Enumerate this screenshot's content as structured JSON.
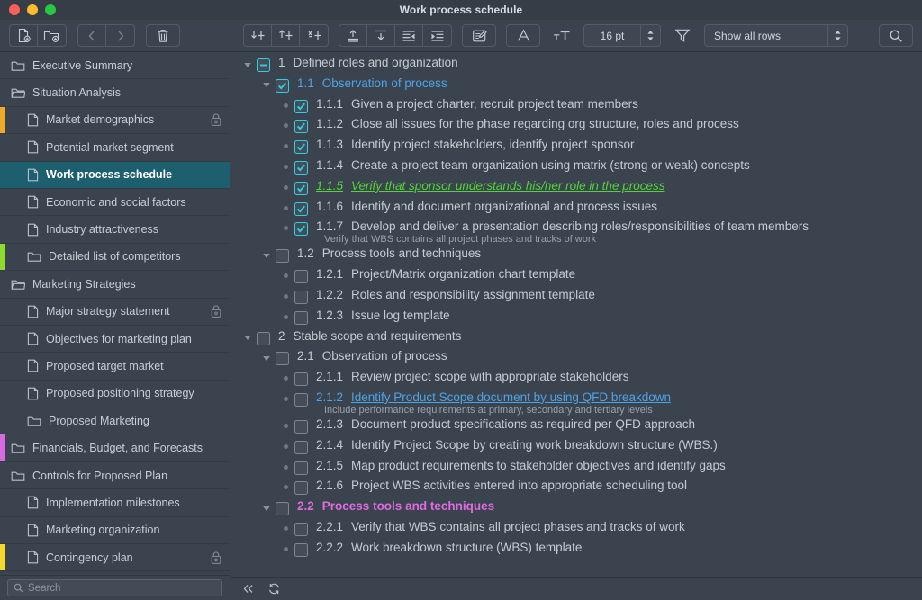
{
  "window": {
    "title": "Work process schedule",
    "traffic_lights": [
      "close",
      "minimize",
      "zoom"
    ]
  },
  "toolbar": {
    "left_groups": [
      {
        "buttons": [
          {
            "name": "new-document-button",
            "icon": "document-add-icon"
          },
          {
            "name": "new-folder-button",
            "icon": "folder-add-icon"
          }
        ]
      },
      {
        "buttons": [
          {
            "name": "back-button",
            "icon": "chevron-left-icon",
            "disabled": true
          },
          {
            "name": "forward-button",
            "icon": "chevron-right-icon",
            "disabled": true
          }
        ]
      },
      {
        "buttons": [
          {
            "name": "delete-button",
            "icon": "trash-icon"
          }
        ]
      }
    ],
    "right_groups": [
      {
        "buttons": [
          {
            "name": "add-row-below-button",
            "icon": "row-add-below-icon"
          },
          {
            "name": "add-row-above-button",
            "icon": "row-add-above-icon"
          },
          {
            "name": "add-child-row-button",
            "icon": "row-add-child-icon"
          }
        ]
      },
      {
        "buttons": [
          {
            "name": "move-row-up-button",
            "icon": "move-up-icon"
          },
          {
            "name": "move-row-down-button",
            "icon": "move-down-icon"
          },
          {
            "name": "outdent-button",
            "icon": "outdent-icon"
          },
          {
            "name": "indent-button",
            "icon": "indent-icon"
          }
        ]
      },
      {
        "buttons": [
          {
            "name": "edit-note-button",
            "icon": "note-edit-icon"
          }
        ]
      },
      {
        "buttons": [
          {
            "name": "font-style-button",
            "icon": "font-a-icon"
          }
        ]
      }
    ],
    "font_size": {
      "label": "16 pt",
      "icon": "text-size-icon"
    },
    "filter": {
      "icon": "funnel-icon",
      "value": "Show all rows"
    },
    "search_button": {
      "icon": "search-icon"
    }
  },
  "sidebar": {
    "items": [
      {
        "label": "Executive Summary",
        "icon": "folder-icon",
        "depth": 0,
        "edge": null,
        "locked": false,
        "selected": false
      },
      {
        "label": "Situation Analysis",
        "icon": "folder-open-icon",
        "depth": 0,
        "edge": null,
        "locked": false,
        "selected": false
      },
      {
        "label": "Market demographics",
        "icon": "document-icon",
        "depth": 1,
        "edge": "#f0a829",
        "locked": true,
        "selected": false
      },
      {
        "label": "Potential market segment",
        "icon": "document-icon",
        "depth": 1,
        "edge": null,
        "locked": false,
        "selected": false
      },
      {
        "label": "Work process schedule",
        "icon": "document-icon",
        "depth": 1,
        "edge": "#1d5f6e",
        "locked": false,
        "selected": true
      },
      {
        "label": "Economic and social factors",
        "icon": "document-icon",
        "depth": 1,
        "edge": null,
        "locked": false,
        "selected": false
      },
      {
        "label": "Industry attractiveness",
        "icon": "document-icon",
        "depth": 1,
        "edge": null,
        "locked": false,
        "selected": false
      },
      {
        "label": "Detailed list of competitors",
        "icon": "folder-icon",
        "depth": 1,
        "edge": "#8fdb2b",
        "locked": false,
        "selected": false
      },
      {
        "label": "Marketing Strategies",
        "icon": "folder-open-icon",
        "depth": 0,
        "edge": null,
        "locked": false,
        "selected": false
      },
      {
        "label": "Major strategy statement",
        "icon": "document-icon",
        "depth": 1,
        "edge": null,
        "locked": true,
        "selected": false
      },
      {
        "label": "Objectives for marketing plan",
        "icon": "document-icon",
        "depth": 1,
        "edge": null,
        "locked": false,
        "selected": false
      },
      {
        "label": "Proposed target market",
        "icon": "document-icon",
        "depth": 1,
        "edge": null,
        "locked": false,
        "selected": false
      },
      {
        "label": "Proposed positioning strategy",
        "icon": "document-icon",
        "depth": 1,
        "edge": null,
        "locked": false,
        "selected": false
      },
      {
        "label": "Proposed Marketing",
        "icon": "folder-icon",
        "depth": 1,
        "edge": null,
        "locked": false,
        "selected": false
      },
      {
        "label": "Financials, Budget, and Forecasts",
        "icon": "folder-icon",
        "depth": 0,
        "edge": "#d66ae0",
        "locked": false,
        "selected": false
      },
      {
        "label": "Controls for Proposed Plan",
        "icon": "folder-icon",
        "depth": 0,
        "edge": null,
        "locked": false,
        "selected": false
      },
      {
        "label": "Implementation milestones",
        "icon": "document-icon",
        "depth": 1,
        "edge": null,
        "locked": false,
        "selected": false
      },
      {
        "label": "Marketing organization",
        "icon": "document-icon",
        "depth": 1,
        "edge": null,
        "locked": false,
        "selected": false
      },
      {
        "label": "Contingency plan",
        "icon": "document-icon",
        "depth": 1,
        "edge": "#f2d92b",
        "locked": true,
        "selected": false
      }
    ],
    "search": {
      "placeholder": "Search",
      "icon": "search-icon"
    }
  },
  "outline": {
    "rows": [
      {
        "indent": 0,
        "marker": "triangle-down",
        "check": "partial",
        "number": "1",
        "title": "Defined roles and organization",
        "note": null,
        "style": "normal"
      },
      {
        "indent": 1,
        "marker": "triangle-down",
        "check": "checked",
        "number": "1.1",
        "title": "Observation of process",
        "note": null,
        "style": "blue"
      },
      {
        "indent": 2,
        "marker": "bullet",
        "check": "checked",
        "number": "1.1.1",
        "title": "Given a project charter, recruit project team members",
        "note": null,
        "style": "normal"
      },
      {
        "indent": 2,
        "marker": "bullet",
        "check": "checked",
        "number": "1.1.2",
        "title": "Close all issues for the phase regarding org structure, roles and process",
        "note": null,
        "style": "normal"
      },
      {
        "indent": 2,
        "marker": "bullet",
        "check": "checked",
        "number": "1.1.3",
        "title": "Identify project stakeholders, identify project sponsor",
        "note": null,
        "style": "normal"
      },
      {
        "indent": 2,
        "marker": "bullet",
        "check": "checked",
        "number": "1.1.4",
        "title": "Create a project team organization using matrix (strong or weak) concepts",
        "note": null,
        "style": "normal"
      },
      {
        "indent": 2,
        "marker": "bullet",
        "check": "checked",
        "number": "1.1.5",
        "title": "Verify that sponsor understands his/her role in the process",
        "note": null,
        "style": "green"
      },
      {
        "indent": 2,
        "marker": "bullet",
        "check": "checked",
        "number": "1.1.6",
        "title": "Identify and document organizational and process issues",
        "note": null,
        "style": "normal"
      },
      {
        "indent": 2,
        "marker": "bullet",
        "check": "checked",
        "number": "1.1.7",
        "title": "Develop and deliver a presentation describing roles/responsibilities of team members",
        "note": "Verify that WBS contains all project phases and tracks of work",
        "style": "normal"
      },
      {
        "indent": 1,
        "marker": "triangle-down",
        "check": "empty",
        "number": "1.2",
        "title": "Process tools and techniques",
        "note": null,
        "style": "normal"
      },
      {
        "indent": 2,
        "marker": "bullet",
        "check": "empty",
        "number": "1.2.1",
        "title": "Project/Matrix organization chart template",
        "note": null,
        "style": "normal"
      },
      {
        "indent": 2,
        "marker": "bullet",
        "check": "empty",
        "number": "1.2.2",
        "title": "Roles and responsibility assignment template",
        "note": null,
        "style": "normal"
      },
      {
        "indent": 2,
        "marker": "bullet",
        "check": "empty",
        "number": "1.2.3",
        "title": "Issue log template",
        "note": null,
        "style": "normal"
      },
      {
        "indent": 0,
        "marker": "triangle-down",
        "check": "empty",
        "number": "2",
        "title": "Stable scope and requirements",
        "note": null,
        "style": "normal"
      },
      {
        "indent": 1,
        "marker": "triangle-down",
        "check": "empty",
        "number": "2.1",
        "title": "Observation of process",
        "note": null,
        "style": "normal"
      },
      {
        "indent": 2,
        "marker": "bullet",
        "check": "empty",
        "number": "2.1.1",
        "title": "Review project scope with appropriate stakeholders",
        "note": null,
        "style": "normal"
      },
      {
        "indent": 2,
        "marker": "bullet",
        "check": "empty",
        "number": "2.1.2",
        "title": "Identify Product Scope document by using QFD breakdown",
        "note": "Include performance requirements at primary, secondary and tertiary levels",
        "style": "blue-link"
      },
      {
        "indent": 2,
        "marker": "bullet",
        "check": "empty",
        "number": "2.1.3",
        "title": "Document product specifications as required per QFD approach",
        "note": null,
        "style": "normal"
      },
      {
        "indent": 2,
        "marker": "bullet",
        "check": "empty",
        "number": "2.1.4",
        "title": "Identify Project Scope by creating work breakdown structure (WBS.)",
        "note": null,
        "style": "normal"
      },
      {
        "indent": 2,
        "marker": "bullet",
        "check": "empty",
        "number": "2.1.5",
        "title": "Map product requirements to stakeholder objectives and identify gaps",
        "note": null,
        "style": "normal"
      },
      {
        "indent": 2,
        "marker": "bullet",
        "check": "empty",
        "number": "2.1.6",
        "title": "Project WBS activities entered into appropriate scheduling tool",
        "note": null,
        "style": "normal"
      },
      {
        "indent": 1,
        "marker": "triangle-down",
        "check": "empty",
        "number": "2.2",
        "title": "Process tools and techniques",
        "note": null,
        "style": "magenta"
      },
      {
        "indent": 2,
        "marker": "bullet",
        "check": "empty",
        "number": "2.2.1",
        "title": "Verify that WBS contains all project phases and tracks of work",
        "note": null,
        "style": "normal"
      },
      {
        "indent": 2,
        "marker": "bullet",
        "check": "empty",
        "number": "2.2.2",
        "title": "Work breakdown structure (WBS) template",
        "note": null,
        "style": "normal"
      }
    ]
  },
  "statusbar": {
    "collapse_all": {
      "icon": "double-chevron-left-icon"
    },
    "refresh": {
      "icon": "refresh-icon"
    }
  },
  "colors": {
    "window_bg": "#3b444e",
    "titlebar_bg": "#353e47",
    "selection": "#1d5f6e",
    "accent_check": "#2ecfe0",
    "link_blue": "#4ea3e8",
    "green": "#53d43a",
    "magenta": "#e06ae0"
  }
}
